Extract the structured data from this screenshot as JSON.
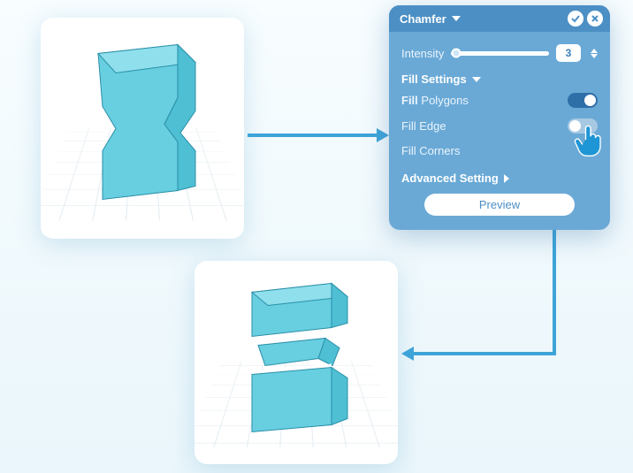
{
  "panel": {
    "title": "Chamfer",
    "intensity": {
      "label": "Intensity",
      "value": "3"
    },
    "fill_settings": {
      "header": "Fill Settings",
      "polygons": {
        "label_prefix": "Fill",
        "label": "Polygons",
        "on": true
      },
      "edge": {
        "label": "Fill Edge",
        "on": false
      },
      "corners": {
        "label": "Fill Corners",
        "on": false
      }
    },
    "advanced": {
      "label": "Advanced Setting"
    },
    "preview": "Preview"
  }
}
